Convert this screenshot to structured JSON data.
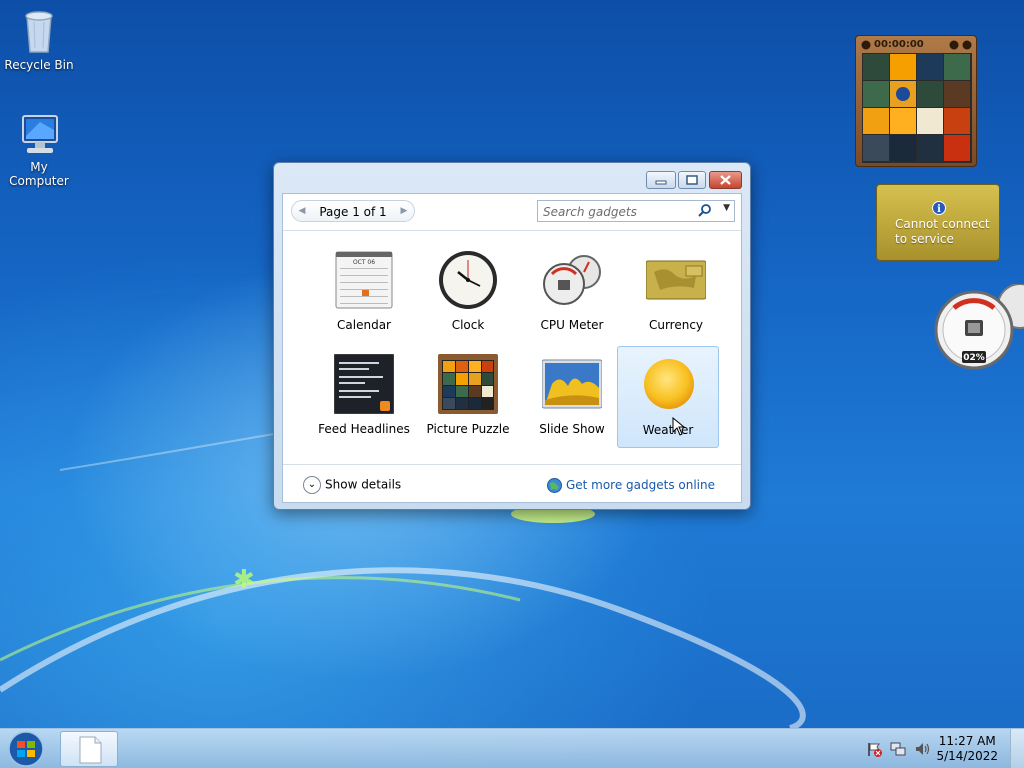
{
  "desktop": {
    "icons": [
      {
        "label": "Recycle Bin",
        "icon": "recycle-bin-icon"
      },
      {
        "label": "My Computer",
        "icon": "computer-icon"
      }
    ]
  },
  "gadget_window": {
    "pager_label": "Page 1 of 1",
    "search_placeholder": "Search gadgets",
    "gadgets": [
      {
        "label": "Calendar",
        "icon": "calendar-icon"
      },
      {
        "label": "Clock",
        "icon": "clock-icon"
      },
      {
        "label": "CPU Meter",
        "icon": "cpu-meter-icon"
      },
      {
        "label": "Currency",
        "icon": "currency-icon"
      },
      {
        "label": "Feed Headlines",
        "icon": "feed-headlines-icon"
      },
      {
        "label": "Picture Puzzle",
        "icon": "picture-puzzle-icon"
      },
      {
        "label": "Slide Show",
        "icon": "slide-show-icon"
      },
      {
        "label": "Weather",
        "icon": "weather-icon",
        "selected": true
      }
    ],
    "calendar_month": "OCT 06",
    "show_details_label": "Show details",
    "get_more_label": "Get more gadgets online"
  },
  "side_gadgets": {
    "puzzle_timer": "00:00:00",
    "currency_message_line1": "Cannot connect",
    "currency_message_line2": "to service",
    "cpu_reading": "02%"
  },
  "taskbar": {
    "time": "11:27 AM",
    "date": "5/14/2022"
  },
  "colors": {
    "desktop_blue": "#1565c4",
    "link_blue": "#1a5aa8",
    "close_red": "#c5452f"
  }
}
